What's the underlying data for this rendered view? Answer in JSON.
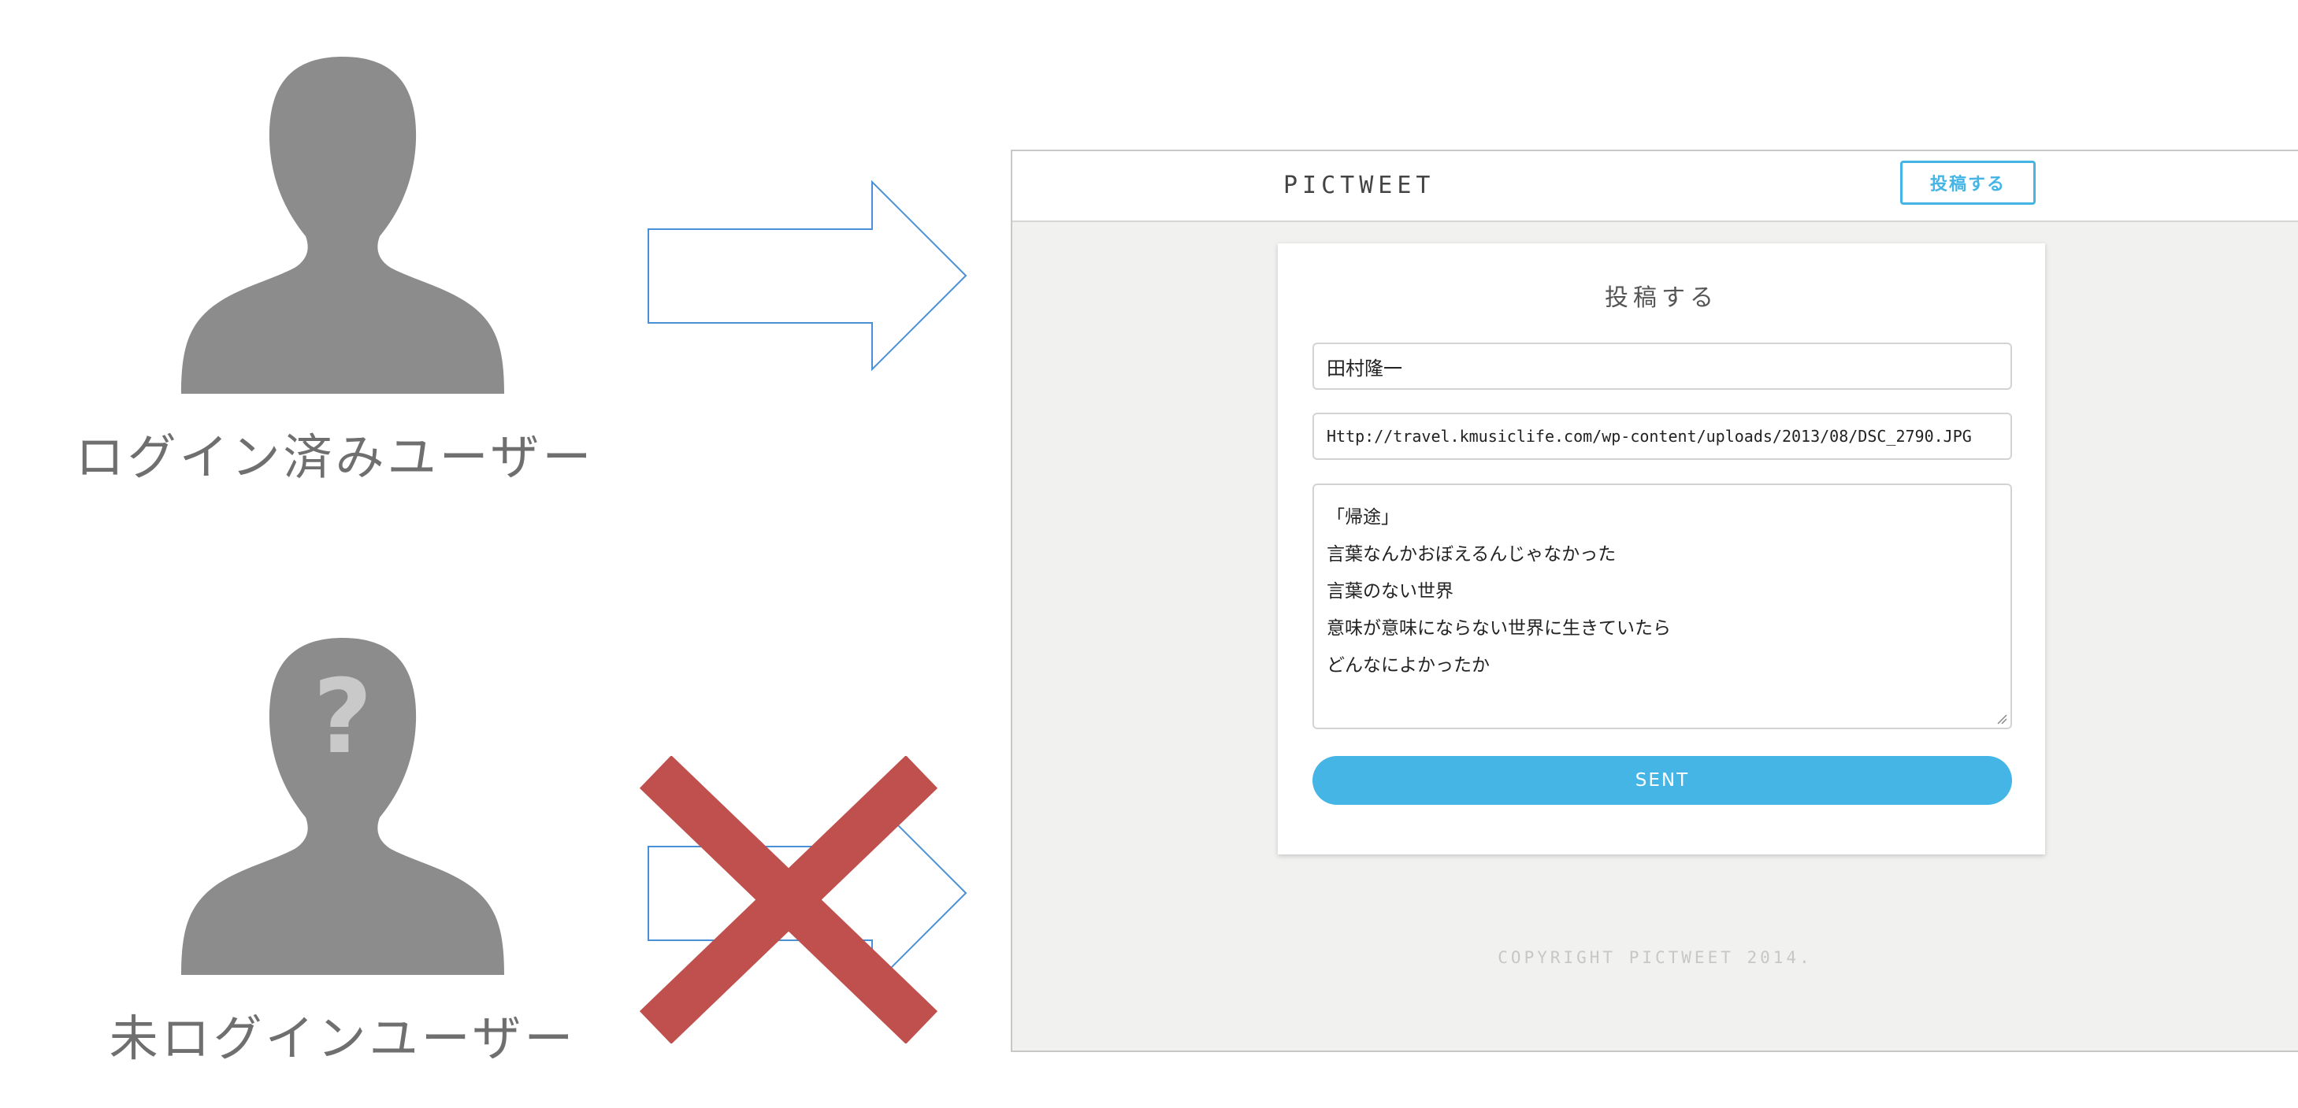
{
  "diagram": {
    "logged_in_label": "ログイン済みユーザー",
    "not_logged_in_label": "未ログインユーザー",
    "unknown_mark": "?",
    "colors": {
      "silhouette": "#8c8c8c",
      "arrow_stroke": "#4a90d9",
      "cross": "#c0504d",
      "question_mark": "#c9c9c9"
    }
  },
  "app": {
    "logo": "PICTWEET",
    "header_post_button": "投稿する",
    "form": {
      "title": "投稿する",
      "name_value": "田村隆一",
      "image_url_value": "Http://travel.kmusiclife.com/wp-content/uploads/2013/08/DSC_2790.JPG",
      "text_lines": [
        "「帰途」",
        "言葉なんかおぼえるんじゃなかった",
        "言葉のない世界",
        "意味が意味にならない世界に生きていたら",
        "どんなによかったか"
      ],
      "submit_label": "SENT"
    },
    "footer_copyright": "COPYRIGHT PICTWEET 2014.",
    "colors": {
      "accent": "#45b5e6",
      "background": "#f1f1ef"
    }
  }
}
